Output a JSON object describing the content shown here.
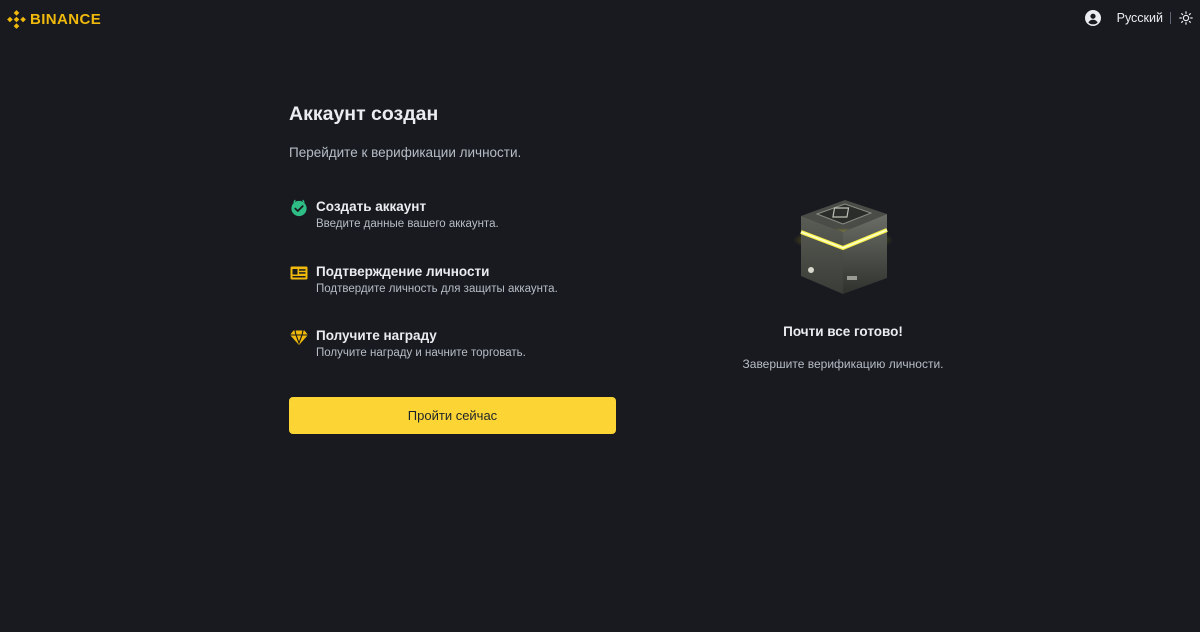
{
  "header": {
    "brand": "BINANCE",
    "language": "Русский"
  },
  "main": {
    "title": "Аккаунт создан",
    "subtitle": "Перейдите к верификации личности.",
    "steps": [
      {
        "icon": "check-circle-icon",
        "title": "Создать аккаунт",
        "desc": "Введите данные вашего аккаунта."
      },
      {
        "icon": "id-card-icon",
        "title": "Подтверждение личности",
        "desc": "Подтвердите личность для защиты аккаунта."
      },
      {
        "icon": "diamond-reward-icon",
        "title": "Получите награду",
        "desc": "Получите награду и начните торговать."
      }
    ],
    "cta_label": "Пройти сейчас"
  },
  "side": {
    "ready_title": "Почти все готово!",
    "ready_desc": "Завершите верификацию личности."
  },
  "colors": {
    "background": "#181a20",
    "accent": "#fcd535",
    "brand": "#f0b90b",
    "success": "#2ebd85"
  }
}
